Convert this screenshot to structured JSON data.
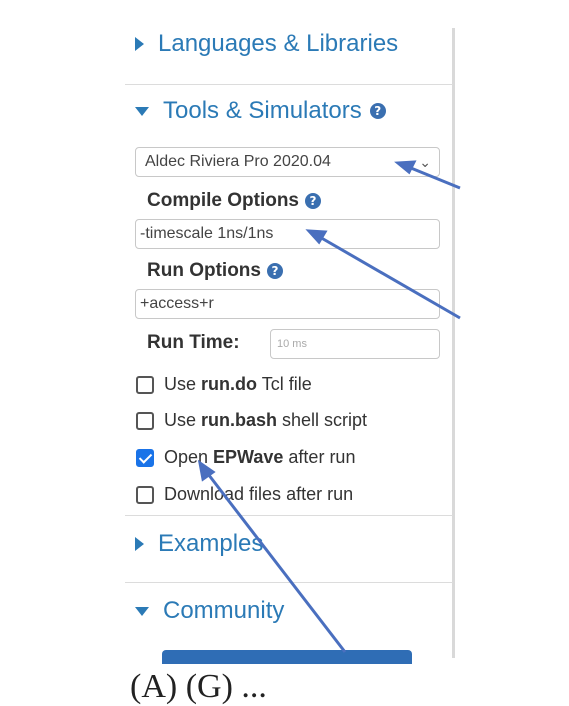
{
  "sections": {
    "languages": {
      "label": "Languages & Libraries",
      "icon": "caret-right-icon"
    },
    "tools": {
      "label": "Tools & Simulators",
      "icon": "caret-down-icon",
      "help": "?"
    },
    "examples": {
      "label": "Examples",
      "icon": "caret-right-icon"
    },
    "community": {
      "label": "Community",
      "icon": "caret-down-icon"
    }
  },
  "simulator": {
    "selected": "Aldec Riviera Pro 2020.04",
    "chevron": "⌄"
  },
  "compile": {
    "label": "Compile Options",
    "value": "-timescale 1ns/1ns",
    "help": "?"
  },
  "run": {
    "label": "Run Options",
    "value": "+access+r",
    "help": "?"
  },
  "run_time": {
    "label": "Run Time:",
    "placeholder": "10 ms"
  },
  "options": [
    {
      "pre": "Use ",
      "bold": "run.do",
      "post": " Tcl file",
      "checked": false
    },
    {
      "pre": "Use ",
      "bold": "run.bash",
      "post": " shell script",
      "checked": false
    },
    {
      "pre": "Open ",
      "bold": "EPWave",
      "post": " after run",
      "checked": true
    },
    {
      "pre": "Download files after run",
      "bold": "",
      "post": "",
      "checked": false
    }
  ],
  "caption": "(A) (G) ..."
}
